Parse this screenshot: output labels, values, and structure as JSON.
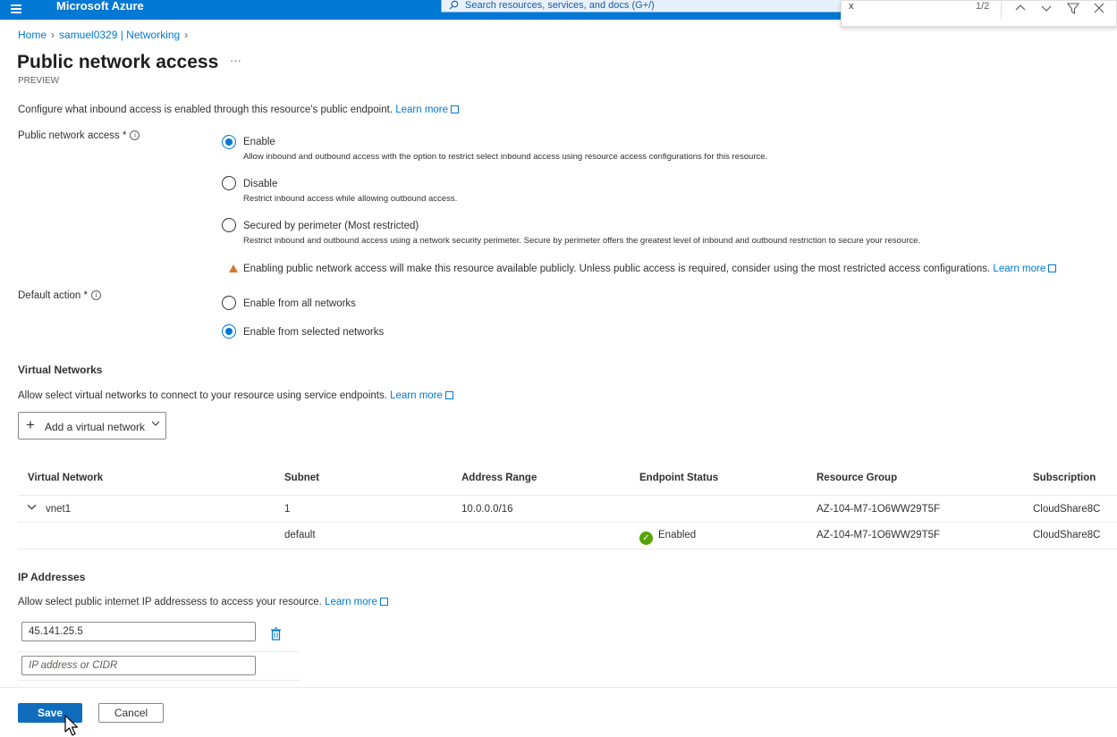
{
  "topbar": {
    "brand": "Microsoft Azure",
    "search_placeholder": "Search resources, services, and docs (G+/)"
  },
  "findbar": {
    "query": "x",
    "count": "1/2",
    "icons": [
      "chevron-up-icon",
      "chevron-down-icon",
      "filter-icon",
      "close-icon"
    ]
  },
  "breadcrumb": {
    "home": "Home",
    "resource": "samuel0329 | Networking"
  },
  "page": {
    "title": "Public network access",
    "ellipsis": "···",
    "preview": "PREVIEW",
    "description": "Configure what inbound access is enabled through this resource's public endpoint.",
    "learn_more": "Learn more"
  },
  "public_access": {
    "label": "Public network access *",
    "options": [
      {
        "label": "Enable",
        "sub": "Allow inbound and outbound access with the option to restrict select inbound access using resource access configurations for this resource.",
        "selected": true
      },
      {
        "label": "Disable",
        "sub": "Restrict inbound access while allowing outbound access.",
        "selected": false
      },
      {
        "label": "Secured by perimeter (Most restricted)",
        "sub": "Restrict inbound and outbound access using a network security perimeter. Secure by perimeter offers the greatest level of inbound and outbound restriction to secure your resource.",
        "selected": false
      }
    ],
    "warning": "Enabling public network access will make this resource available publicly. Unless public access is required, consider using the most restricted access configurations.",
    "warning_link": "Learn more"
  },
  "default_action": {
    "label": "Default action *",
    "options": [
      {
        "label": "Enable from all networks",
        "selected": false
      },
      {
        "label": "Enable from selected networks",
        "selected": true
      }
    ]
  },
  "vnets": {
    "heading": "Virtual Networks",
    "description": "Allow select virtual networks to connect to your resource using service endpoints.",
    "learn_more": "Learn more",
    "add_button": "Add a virtual network",
    "columns": [
      "Virtual Network",
      "Subnet",
      "Address Range",
      "Endpoint Status",
      "Resource Group",
      "Subscription"
    ],
    "rows": [
      {
        "network": "vnet1",
        "subnet": "1",
        "range": "10.0.0.0/16",
        "status": "",
        "group": "AZ-104-M7-1O6WW29T5F",
        "subscription": "CloudShare8C"
      },
      {
        "network": "",
        "subnet": "default",
        "range": "",
        "status": "Enabled",
        "group": "AZ-104-M7-1O6WW29T5F",
        "subscription": "CloudShare8C"
      }
    ]
  },
  "ip": {
    "heading": "IP Addresses",
    "description": "Allow select public internet IP addressess to access your resource.",
    "learn_more": "Learn more",
    "entries": [
      "45.141.25.5"
    ],
    "placeholder": "IP address or CIDR"
  },
  "footer": {
    "save": "Save",
    "cancel": "Cancel"
  }
}
